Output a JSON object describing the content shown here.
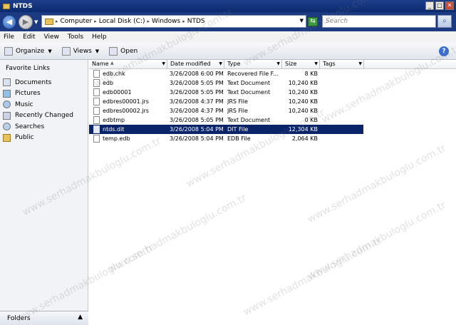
{
  "window": {
    "title": "NTDS"
  },
  "address": {
    "crumbs": [
      "Computer",
      "Local Disk (C:)",
      "Windows",
      "NTDS"
    ]
  },
  "search": {
    "placeholder": "Search"
  },
  "menu": [
    "File",
    "Edit",
    "View",
    "Tools",
    "Help"
  ],
  "toolbar": {
    "organize": "Organize",
    "views": "Views",
    "open": "Open"
  },
  "sidebar": {
    "heading": "Favorite Links",
    "items": [
      "Documents",
      "Pictures",
      "Music",
      "Recently Changed",
      "Searches",
      "Public"
    ],
    "folders_label": "Folders"
  },
  "columns": [
    "Name",
    "Date modified",
    "Type",
    "Size",
    "Tags"
  ],
  "files": [
    {
      "name": "edb.chk",
      "date": "3/26/2008 6:00 PM",
      "type": "Recovered File F...",
      "size": "8 KB"
    },
    {
      "name": "edb",
      "date": "3/26/2008 5:05 PM",
      "type": "Text Document",
      "size": "10,240 KB"
    },
    {
      "name": "edb00001",
      "date": "3/26/2008 5:05 PM",
      "type": "Text Document",
      "size": "10,240 KB"
    },
    {
      "name": "edbres00001.jrs",
      "date": "3/26/2008 4:37 PM",
      "type": "JRS File",
      "size": "10,240 KB"
    },
    {
      "name": "edbres00002.jrs",
      "date": "3/26/2008 4:37 PM",
      "type": "JRS File",
      "size": "10,240 KB"
    },
    {
      "name": "edbtmp",
      "date": "3/26/2008 5:05 PM",
      "type": "Text Document",
      "size": "0 KB"
    },
    {
      "name": "ntds.dit",
      "date": "3/26/2008 5:04 PM",
      "type": "DIT File",
      "size": "12,304 KB"
    },
    {
      "name": "temp.edb",
      "date": "3/26/2008 5:04 PM",
      "type": "EDB File",
      "size": "2,064 KB"
    }
  ],
  "selected_row": 6,
  "watermark": "www.serhadmakbuloglu.com.tr",
  "colors": {
    "titlebar": "#0b2a6e",
    "selection": "#0a246a"
  }
}
